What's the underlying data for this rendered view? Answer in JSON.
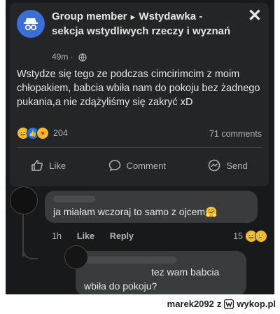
{
  "post": {
    "header_group_member": "Group member",
    "header_arrow": "►",
    "header_group_name": "Wstydawka - sekcja wstydliwych rzeczy i wyznań",
    "time": "49m",
    "text": "Wstydze się tego ze podczas cimcirimcim z moim chłopakiem, babcia wbiła nam do pokoju bez żadnego pukania,a nie zdążyliśmy się zakryć xD",
    "reaction_count": "204",
    "comments_count": "71 comments",
    "actions": {
      "like": "Like",
      "comment": "Comment",
      "send": "Send"
    },
    "icons": {
      "close": "close-icon",
      "group": "group-incognito-icon",
      "globe": "globe-icon"
    }
  },
  "comments": [
    {
      "text": "ja miałam wczoraj to samo z ojcem🤗",
      "time": "1h",
      "like_label": "Like",
      "reply_label": "Reply",
      "reaction_count": "15"
    },
    {
      "text": "tez wam babcia wbiła do pokoju?"
    }
  ],
  "watermark": {
    "user": "marek2092",
    "z": "z",
    "site": "wykop.pl"
  },
  "colors": {
    "background": "#18191a",
    "card": "#242526",
    "bubble": "#3a3b3c",
    "text_primary": "#e4e6eb",
    "text_secondary": "#b0b3b8",
    "accent": "#1877f2"
  }
}
